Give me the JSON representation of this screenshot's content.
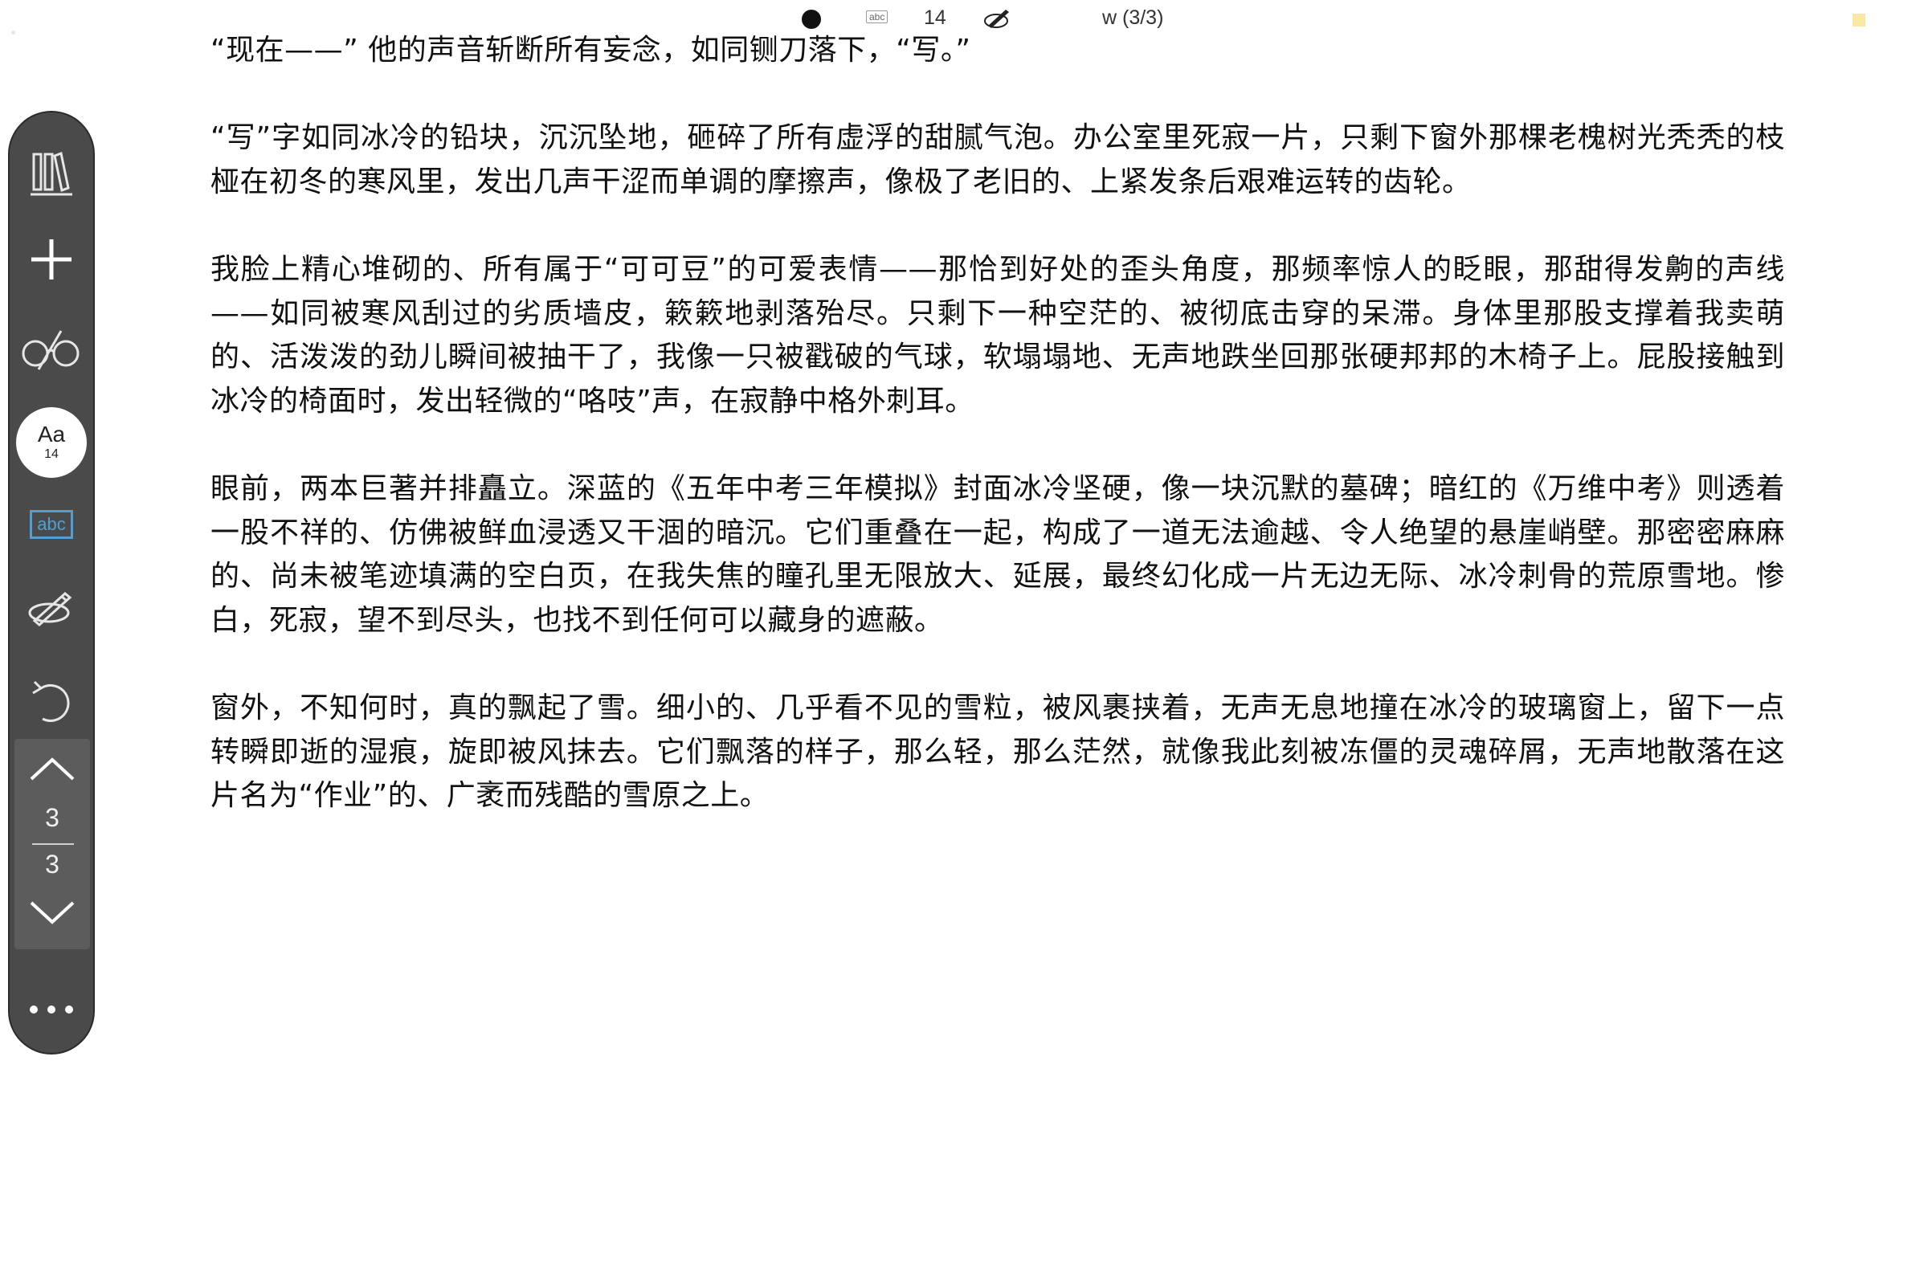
{
  "status_bar": {
    "font_size": "14",
    "progress": "w (3/3)"
  },
  "toolbar": {
    "items": [
      {
        "name": "library",
        "icon": "books-icon"
      },
      {
        "name": "add",
        "icon": "plus-icon"
      },
      {
        "name": "reading-mode",
        "icon": "glasses-icon"
      },
      {
        "name": "font-size",
        "label": "Aa",
        "value": "14"
      },
      {
        "name": "text-mode",
        "label": "abc"
      },
      {
        "name": "annotate",
        "icon": "pen-icon"
      },
      {
        "name": "undo",
        "icon": "undo-icon"
      }
    ],
    "pager": {
      "current": "3",
      "total": "3"
    },
    "more_icon": "more-dots-icon"
  },
  "content": {
    "paragraphs": [
      "“现在——” 他的声音斩断所有妄念，如同铡刀落下，“写。”",
      "“写”字如同冰冷的铅块，沉沉坠地，砸碎了所有虚浮的甜腻气泡。办公室里死寂一片，只剩下窗外那棵老槐树光秃秃的枝桠在初冬的寒风里，发出几声干涩而单调的摩擦声，像极了老旧的、上紧发条后艰难运转的齿轮。",
      "我脸上精心堆砌的、所有属于“可可豆”的可爱表情——那恰到好处的歪头角度，那频率惊人的眨眼，那甜得发齁的声线——如同被寒风刮过的劣质墙皮，簌簌地剥落殆尽。只剩下一种空茫的、被彻底击穿的呆滞。身体里那股支撑着我卖萌的、活泼泼的劲儿瞬间被抽干了，我像一只被戳破的气球，软塌塌地、无声地跌坐回那张硬邦邦的木椅子上。屁股接触到冰冷的椅面时，发出轻微的“咯吱”声，在寂静中格外刺耳。",
      "眼前，两本巨著并排矗立。深蓝的《五年中考三年模拟》封面冰冷坚硬，像一块沉默的墓碑；暗红的《万维中考》则透着一股不祥的、仿佛被鲜血浸透又干涸的暗沉。它们重叠在一起，构成了一道无法逾越、令人绝望的悬崖峭壁。那密密麻麻的、尚未被笔迹填满的空白页，在我失焦的瞳孔里无限放大、延展，最终幻化成一片无边无际、冰冷刺骨的荒原雪地。惨白，死寂，望不到尽头，也找不到任何可以藏身的遮蔽。",
      "窗外，不知何时，真的飘起了雪。细小的、几乎看不见的雪粒，被风裹挟着，无声无息地撞在冰冷的玻璃窗上，留下一点转瞬即逝的湿痕，旋即被风抹去。它们飘落的样子，那么轻，那么茫然，就像我此刻被冻僵的灵魂碎屑，无声地散落在这片名为“作业”的、广袤而残酷的雪原之上。"
    ]
  },
  "colors": {
    "toolbar_bg": "#4a4a4a",
    "accent_blue": "#4f9fd6",
    "note_yellow": "#fbe8a6"
  }
}
